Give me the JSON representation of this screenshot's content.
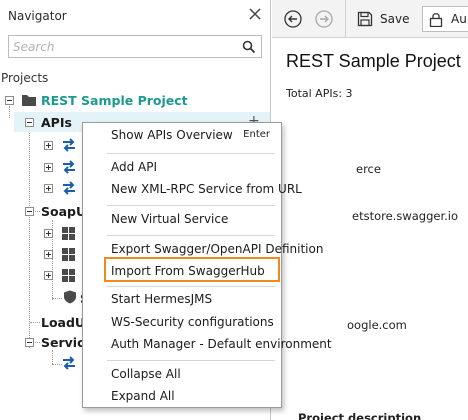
{
  "navigator": {
    "title": "Navigator",
    "search_placeholder": "Search",
    "projects_label": "Projects",
    "tree": {
      "project": "REST Sample Project",
      "apis": "APIs",
      "soapui": "SoapU",
      "loadui": "LoadU",
      "service": "Servic",
      "shield_partial": "S"
    }
  },
  "toolbar": {
    "save_label": "Save",
    "auth_label": "Au"
  },
  "main": {
    "title": "REST Sample Project",
    "total_apis": "Total APIs: 3",
    "fragments": [
      "erce",
      "etstore.swagger.io",
      "oogle.com",
      "Project description"
    ]
  },
  "context_menu": {
    "items": [
      {
        "label": "Show APIs Overview",
        "shortcut": "Enter"
      },
      {
        "label": "Add API"
      },
      {
        "label": "New XML-RPC Service from URL"
      },
      {
        "label": "New Virtual Service"
      },
      {
        "label": "Export Swagger/OpenAPI Definition"
      },
      {
        "label": "Import From SwaggerHub",
        "highlighted": true
      },
      {
        "label": "Start HermesJMS"
      },
      {
        "label": "WS-Security configurations"
      },
      {
        "label": "Auth Manager - Default environment"
      },
      {
        "label": "Collapse All"
      },
      {
        "label": "Expand All"
      }
    ]
  },
  "colors": {
    "project_accent": "#1d9a8f",
    "api_icon_blue": "#1d5fa8",
    "highlight_orange": "#ef8a22",
    "selected_row": "#e4f3f8"
  },
  "icons": [
    "close-icon",
    "search-icon",
    "folder-icon",
    "api-arrows-icon",
    "grid-icon",
    "shield-icon",
    "back-arrow-icon",
    "forward-arrow-icon",
    "save-icon",
    "lock-icon"
  ]
}
